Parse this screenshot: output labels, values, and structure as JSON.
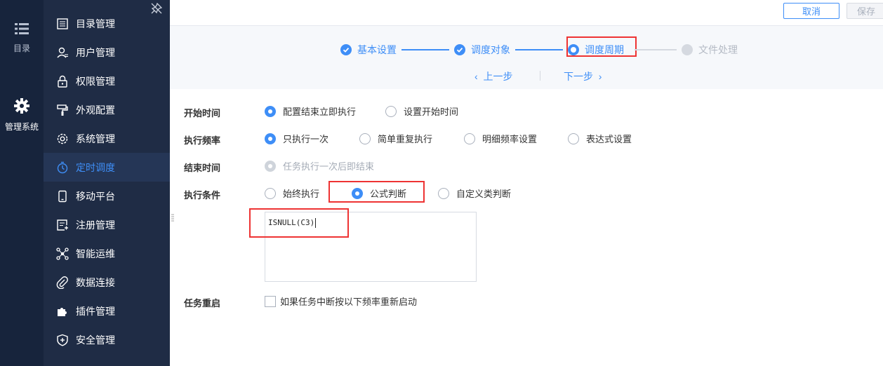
{
  "rail": {
    "directory_label": "目录",
    "system_label": "管理系统"
  },
  "sidebar": {
    "items": [
      {
        "label": "目录管理",
        "icon": "list-icon"
      },
      {
        "label": "用户管理",
        "icon": "user-icon"
      },
      {
        "label": "权限管理",
        "icon": "lock-icon"
      },
      {
        "label": "外观配置",
        "icon": "paint-roller-icon"
      },
      {
        "label": "系统管理",
        "icon": "gear-icon"
      },
      {
        "label": "定时调度",
        "icon": "stopwatch-icon",
        "active": true
      },
      {
        "label": "移动平台",
        "icon": "mobile-icon"
      },
      {
        "label": "注册管理",
        "icon": "register-icon"
      },
      {
        "label": "智能运维",
        "icon": "network-icon"
      },
      {
        "label": "数据连接",
        "icon": "paperclip-icon"
      },
      {
        "label": "插件管理",
        "icon": "puzzle-icon"
      },
      {
        "label": "安全管理",
        "icon": "shield-icon"
      }
    ]
  },
  "toolbar": {
    "cancel_label": "取消",
    "save_label": "保存"
  },
  "steps": {
    "items": [
      {
        "label": "基本设置",
        "state": "done"
      },
      {
        "label": "调度对象",
        "state": "done"
      },
      {
        "label": "调度周期",
        "state": "current"
      },
      {
        "label": "文件处理",
        "state": "pending"
      }
    ],
    "prev_label": "上一步",
    "next_label": "下一步"
  },
  "form": {
    "start_time": {
      "label": "开始时间",
      "options": [
        "配置结束立即执行",
        "设置开始时间"
      ],
      "selected": "配置结束立即执行"
    },
    "frequency": {
      "label": "执行频率",
      "options": [
        "只执行一次",
        "简单重复执行",
        "明细频率设置",
        "表达式设置"
      ],
      "selected": "只执行一次"
    },
    "end_time": {
      "label": "结束时间",
      "options": [
        "任务执行一次后即结束"
      ],
      "selected": "任务执行一次后即结束"
    },
    "condition": {
      "label": "执行条件",
      "options": [
        "始终执行",
        "公式判断",
        "自定义类判断"
      ],
      "selected": "公式判断",
      "formula": "ISNULL(C3)"
    },
    "restart": {
      "label": "任务重启",
      "checkbox_label": "如果任务中断按以下频率重新启动",
      "checked": false
    }
  },
  "colors": {
    "accent": "#3e8ef7",
    "sidebar_bg": "#1f2c45",
    "rail_bg": "#17243c",
    "highlight": "#ee3333"
  }
}
